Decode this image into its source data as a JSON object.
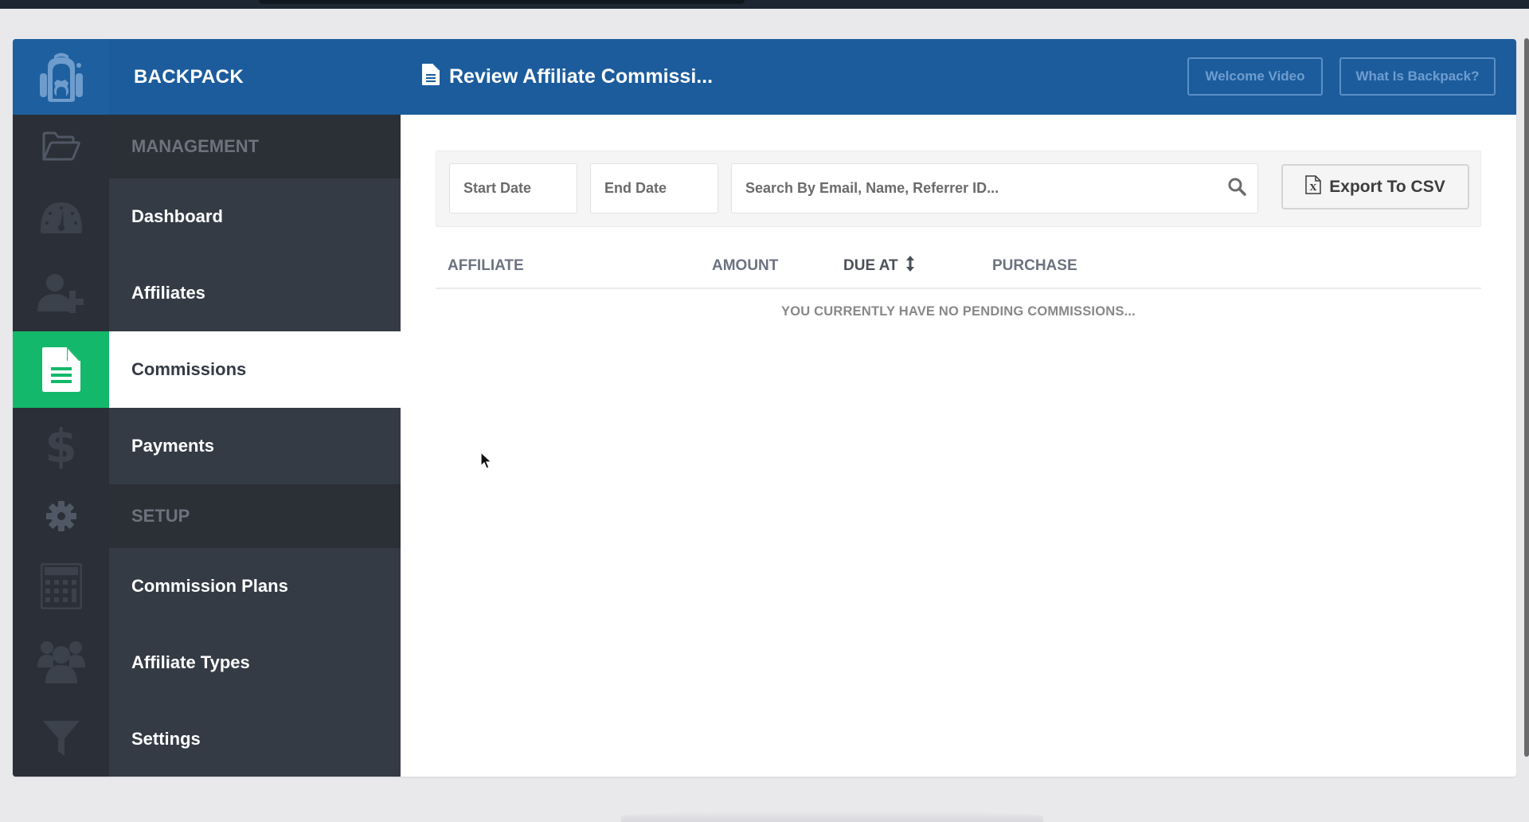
{
  "header": {
    "brand": "BACKPACK",
    "page_title": "Review Affiliate Commissi...",
    "buttons": {
      "welcome_video": "Welcome Video",
      "what_is_backpack": "What Is Backpack?"
    }
  },
  "sidebar": {
    "items": [
      {
        "type": "section",
        "label": "MANAGEMENT",
        "icon": "folder-open-icon"
      },
      {
        "type": "link",
        "label": "Dashboard",
        "icon": "dashboard-gauge-icon"
      },
      {
        "type": "link",
        "label": "Affiliates",
        "icon": "user-plus-icon"
      },
      {
        "type": "link",
        "label": "Commissions",
        "icon": "document-icon",
        "active": true
      },
      {
        "type": "link",
        "label": "Payments",
        "icon": "dollar-icon"
      },
      {
        "type": "section",
        "label": "SETUP",
        "icon": "gear-icon"
      },
      {
        "type": "link",
        "label": "Commission Plans",
        "icon": "calculator-icon"
      },
      {
        "type": "link",
        "label": "Affiliate Types",
        "icon": "users-group-icon"
      },
      {
        "type": "link",
        "label": "Settings",
        "icon": "filter-funnel-icon"
      }
    ]
  },
  "filters": {
    "start_date_placeholder": "Start Date",
    "end_date_placeholder": "End Date",
    "search_placeholder": "Search By Email, Name, Referrer ID...",
    "export_label": "Export To CSV"
  },
  "table": {
    "columns": [
      "AFFILIATE",
      "AMOUNT",
      "DUE AT",
      "PURCHASE"
    ],
    "sorted_column": "DUE AT",
    "rows": [],
    "empty_message": "YOU CURRENTLY HAVE NO PENDING COMMISSIONS..."
  },
  "colors": {
    "header_blue": "#1c5c9c",
    "active_green": "#14b86a",
    "sidebar_dark": "#343b44"
  }
}
